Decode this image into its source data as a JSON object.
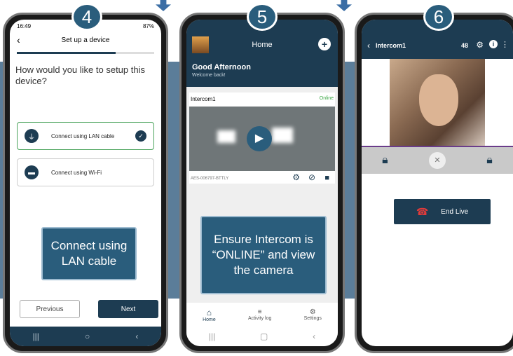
{
  "steps": [
    "4",
    "5",
    "6"
  ],
  "phone1": {
    "time": "16:49",
    "status_right": "87%",
    "title": "Set up a device",
    "progress": 0.72,
    "question": "How would you like to setup this device?",
    "options": [
      {
        "label": "Connect using LAN cable",
        "selected": true
      },
      {
        "label": "Connect using Wi-Fi",
        "selected": false
      }
    ],
    "previous": "Previous",
    "next": "Next",
    "callout": "Connect using LAN cable"
  },
  "phone2": {
    "title": "Home",
    "greeting": "Good Afternoon",
    "welcome": "Welcome back!",
    "device": "Intercom1",
    "status": "Online",
    "serial": "AES-006797-BTTLY",
    "tabs": [
      "Home",
      "Activity log",
      "Settings"
    ],
    "callout": "Ensure Intercom is “ONLINE” and view the camera"
  },
  "phone3": {
    "title": "Intercom1",
    "badge": "48",
    "end_live": "End Live"
  },
  "colors": {
    "primary": "#1d3c52",
    "band": "#5b7d99",
    "online": "#3aa745",
    "step": "#2a5d7c",
    "end_icon": "#e03b3b"
  }
}
